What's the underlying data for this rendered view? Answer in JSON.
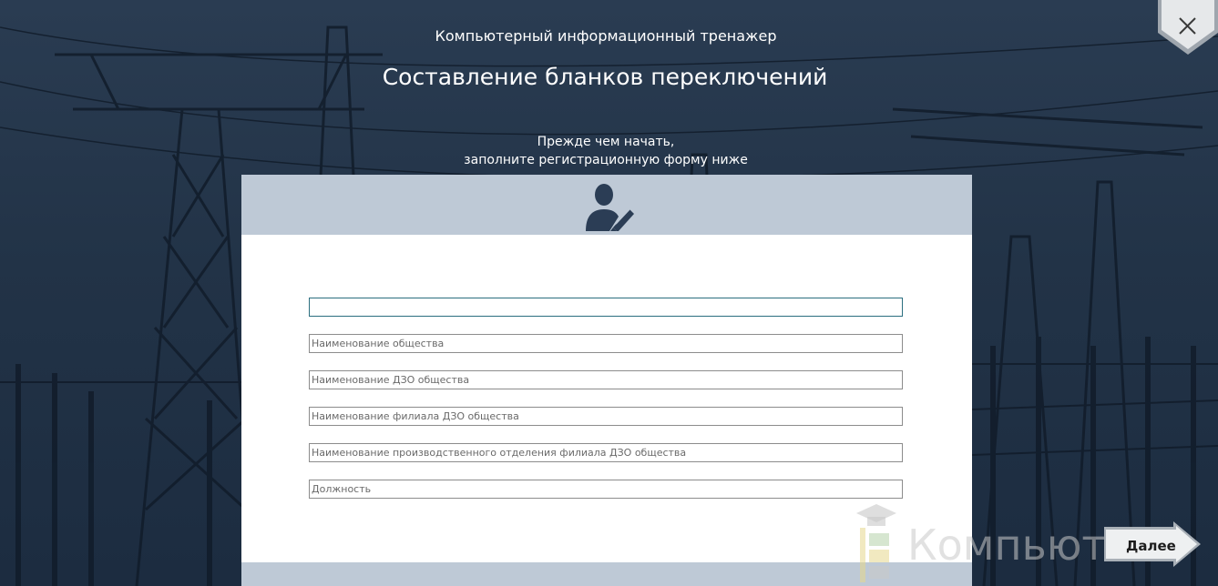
{
  "header": {
    "subtitle": "Компьютерный информационный тренажер",
    "title": "Составление бланков переключений"
  },
  "intro": {
    "line1": "Прежде чем начать,",
    "line2": "заполните регистрационную форму ниже"
  },
  "form": {
    "fields": [
      {
        "value": "",
        "placeholder": ""
      },
      {
        "value": "",
        "placeholder": "Наименование общества"
      },
      {
        "value": "",
        "placeholder": "Наименование ДЗО общества"
      },
      {
        "value": "",
        "placeholder": "Наименование филиала ДЗО общества"
      },
      {
        "value": "",
        "placeholder": "Наименование производственного отделения филиала ДЗО общества"
      },
      {
        "value": "",
        "placeholder": "Должность"
      }
    ]
  },
  "buttons": {
    "next_label": "Далее"
  },
  "watermark": {
    "text": "Компьютан"
  },
  "icons": {
    "close": "close-icon",
    "user_edit": "user-edit-icon",
    "watermark_logo": "graduation-cap-logo-icon"
  },
  "colors": {
    "background": "#223347",
    "panel_header": "#bec9d6",
    "icon": "#2b3d55",
    "active_border": "#2b6e7f"
  }
}
